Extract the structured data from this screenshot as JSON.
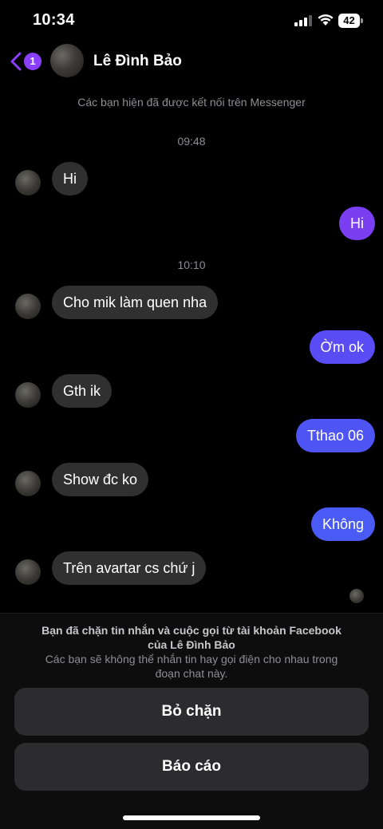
{
  "status_bar": {
    "time": "10:34",
    "battery": "42",
    "icons": [
      "signal-icon",
      "wifi-icon",
      "battery-icon"
    ]
  },
  "header": {
    "unread_count": "1",
    "contact_name": "Lê Đình Bảo",
    "back_icon": "chevron-left-icon"
  },
  "chat": {
    "system_note": "Các bạn hiện đã được kết nối trên Messenger",
    "timestamps": [
      "09:48",
      "10:10"
    ],
    "messages": [
      {
        "from": "them",
        "text": "Hi"
      },
      {
        "from": "me",
        "text": "Hi"
      },
      {
        "from": "them",
        "text": "Cho mik làm quen nha"
      },
      {
        "from": "me",
        "text": "Ờm ok"
      },
      {
        "from": "them",
        "text": "Gth ik"
      },
      {
        "from": "me",
        "text": "Tthao 06"
      },
      {
        "from": "them",
        "text": "Show đc ko"
      },
      {
        "from": "me",
        "text": "Không"
      },
      {
        "from": "them",
        "text": "Trên avartar cs chứ j"
      }
    ]
  },
  "bottom_panel": {
    "notice_line1": "Bạn đã chặn tin nhắn và cuộc gọi từ tài khoản Facebook",
    "notice_line2": "của Lê Đình Bảo",
    "notice_line3": "Các bạn sẽ không thể nhắn tin hay gọi điện cho nhau trong",
    "notice_line4": "đoạn chat này.",
    "unblock_label": "Bỏ chặn",
    "report_label": "Báo cáo"
  },
  "colors": {
    "background": "#000000",
    "incoming_bubble": "#303030",
    "outgoing_purple": "#7b3ff2",
    "outgoing_blue": "#4a5bf5",
    "badge": "#8a3ffc"
  }
}
